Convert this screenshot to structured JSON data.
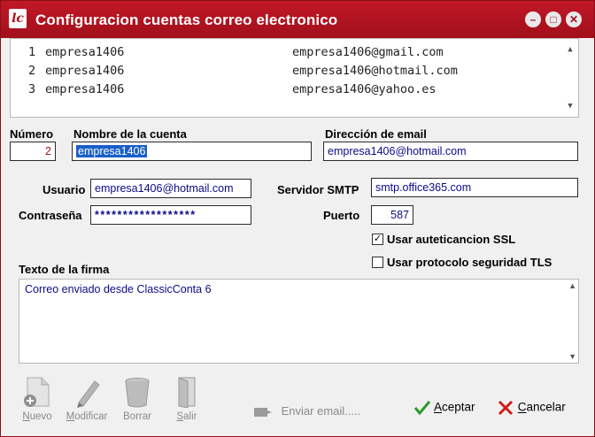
{
  "window": {
    "title": "Configuracion cuentas correo electronico",
    "icon_text": "lc",
    "controls": {
      "minimize": "–",
      "maximize": "□",
      "close": "✕"
    }
  },
  "accounts": [
    {
      "num": "1",
      "name": "empresa1406",
      "email": "empresa1406@gmail.com"
    },
    {
      "num": "2",
      "name": "empresa1406",
      "email": "empresa1406@hotmail.com"
    },
    {
      "num": "3",
      "name": "empresa1406",
      "email": "empresa1406@yahoo.es"
    }
  ],
  "form": {
    "numero_label": "Número",
    "numero_value": "2",
    "nombre_label": "Nombre de la cuenta",
    "nombre_value": "empresa1406",
    "direccion_label": "Dirección de email",
    "direccion_value": "empresa1406@hotmail.com",
    "usuario_label": "Usuario",
    "usuario_value": "empresa1406@hotmail.com",
    "contrasena_label": "Contraseña",
    "contrasena_value": "******************",
    "servidor_label": "Servidor SMTP",
    "servidor_value": "smtp.office365.com",
    "puerto_label": "Puerto",
    "puerto_value": "587",
    "ssl_label": "Usar auteticancion SSL",
    "ssl_checked": true,
    "tls_label": "Usar protocolo seguridad TLS",
    "tls_checked": false,
    "firma_label": "Texto de la firma",
    "firma_value": "Correo enviado desde ClassicConta 6"
  },
  "toolbar": {
    "nuevo": "Nuevo",
    "modificar": "Modificar",
    "borrar": "Borrar",
    "salir": "Salir",
    "enviar": "Enviar email.....",
    "aceptar": "Aceptar",
    "cancelar": "Cancelar"
  },
  "colors": {
    "titlebar": "#b0101d",
    "selection": "#1a5fc9",
    "field_text": "#0b0b8a",
    "numero_text": "#b0101d"
  }
}
